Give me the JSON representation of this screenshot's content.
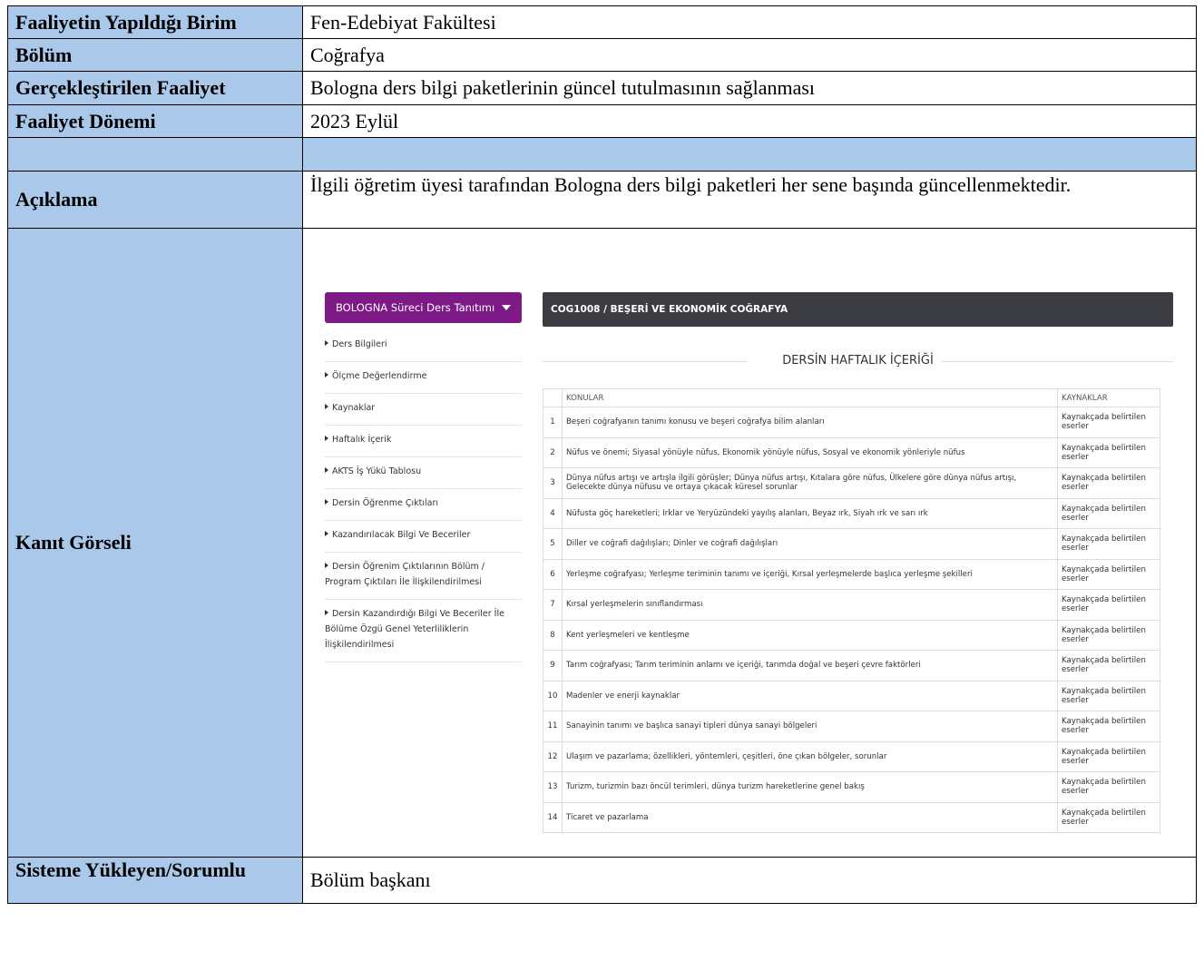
{
  "form": {
    "birim_label": "Faaliyetin Yapıldığı Birim",
    "birim_value": "Fen-Edebiyat Fakültesi",
    "bolum_label": "Bölüm",
    "bolum_value": "Coğrafya",
    "faaliyet_label": "Gerçekleştirilen Faaliyet",
    "faaliyet_value": "Bologna ders bilgi paketlerinin güncel tutulmasının sağlanması",
    "donem_label": "Faaliyet Dönemi",
    "donem_value": "2023 Eylül",
    "aciklama_label": "Açıklama",
    "aciklama_value": "İlgili öğretim üyesi tarafından Bologna ders bilgi paketleri her sene başında güncellenmektedir.",
    "kanit_label": "Kanıt Görseli",
    "sorumlu_label": "Sisteme Yükleyen/Sorumlu",
    "sorumlu_value": "Bölüm başkanı"
  },
  "evidence": {
    "menu_title": "BOLOGNA Süreci Ders Tanıtımı",
    "menu_items": [
      "Ders Bilgileri",
      "Ölçme Değerlendirme",
      "Kaynaklar",
      "Haftalık İçerik",
      "AKTS İş Yükü Tablosu",
      "Dersin Öğrenme Çıktıları",
      "Kazandırılacak Bilgi Ve Beceriler",
      "Dersin Öğrenim Çıktılarının Bölüm / Program Çıktıları İle İlişkilendirilmesi",
      "Dersin Kazandırdığı Bilgi Ve Beceriler İle Bölüme Özgü Genel Yeterliliklerin İlişkilendirilmesi"
    ],
    "course_title": "COG1008 / BEŞERİ VE EKONOMİK COĞRAFYA",
    "section_title": "DERSİN HAFTALIK İÇERİĞİ",
    "col_konular": "KONULAR",
    "col_kaynaklar": "KAYNAKLAR",
    "rows": [
      {
        "n": "1",
        "konu": "Beşeri coğrafyanın tanımı konusu ve beşeri coğrafya bilim alanları",
        "kaynak": "Kaynakçada belirtilen eserler"
      },
      {
        "n": "2",
        "konu": "Nüfus ve önemi; Siyasal yönüyle nüfus, Ekonomik yönüyle nüfus, Sosyal ve ekonomik yönleriyle nüfus",
        "kaynak": "Kaynakçada belirtilen eserler"
      },
      {
        "n": "3",
        "konu": "Dünya nüfus artışı ve artışla ilgili görüşler; Dünya nüfus artışı, Kıtalara göre nüfus, Ülkelere göre dünya nüfus artışı, Gelecekte dünya nüfusu ve ortaya çıkacak küresel sorunlar",
        "kaynak": "Kaynakçada belirtilen eserler"
      },
      {
        "n": "4",
        "konu": "Nüfusta göç hareketleri; Irklar ve Yeryüzündeki yayılış alanları, Beyaz ırk, Siyah ırk ve sarı ırk",
        "kaynak": "Kaynakçada belirtilen eserler"
      },
      {
        "n": "5",
        "konu": "Diller ve coğrafi dağılışları; Dinler ve coğrafi dağılışları",
        "kaynak": "Kaynakçada belirtilen eserler"
      },
      {
        "n": "6",
        "konu": "Yerleşme coğrafyası; Yerleşme teriminin tanımı ve içeriği, Kırsal yerleşmelerde başlıca yerleşme şekilleri",
        "kaynak": "Kaynakçada belirtilen eserler"
      },
      {
        "n": "7",
        "konu": "Kırsal yerleşmelerin sınıflandırması",
        "kaynak": "Kaynakçada belirtilen eserler"
      },
      {
        "n": "8",
        "konu": "Kent yerleşmeleri ve kentleşme",
        "kaynak": "Kaynakçada belirtilen eserler"
      },
      {
        "n": "9",
        "konu": "Tarım coğrafyası; Tarım teriminin anlamı ve içeriği, tarımda doğal ve beşeri çevre faktörleri",
        "kaynak": "Kaynakçada belirtilen eserler"
      },
      {
        "n": "10",
        "konu": "Madenler ve enerji kaynaklar",
        "kaynak": "Kaynakçada belirtilen eserler"
      },
      {
        "n": "11",
        "konu": "Sanayinin tanımı ve başlıca sanayi tipleri dünya sanayi bölgeleri",
        "kaynak": "Kaynakçada belirtilen eserler"
      },
      {
        "n": "12",
        "konu": "Ulaşım ve pazarlama; özellikleri, yöntemleri, çeşitleri, öne çıkan bölgeler, sorunlar",
        "kaynak": "Kaynakçada belirtilen eserler"
      },
      {
        "n": "13",
        "konu": "Turizm, turizmin bazı öncül terimleri, dünya turizm hareketlerine genel bakış",
        "kaynak": "Kaynakçada belirtilen eserler"
      },
      {
        "n": "14",
        "konu": "Ticaret ve pazarlama",
        "kaynak": "Kaynakçada belirtilen eserler"
      }
    ]
  }
}
